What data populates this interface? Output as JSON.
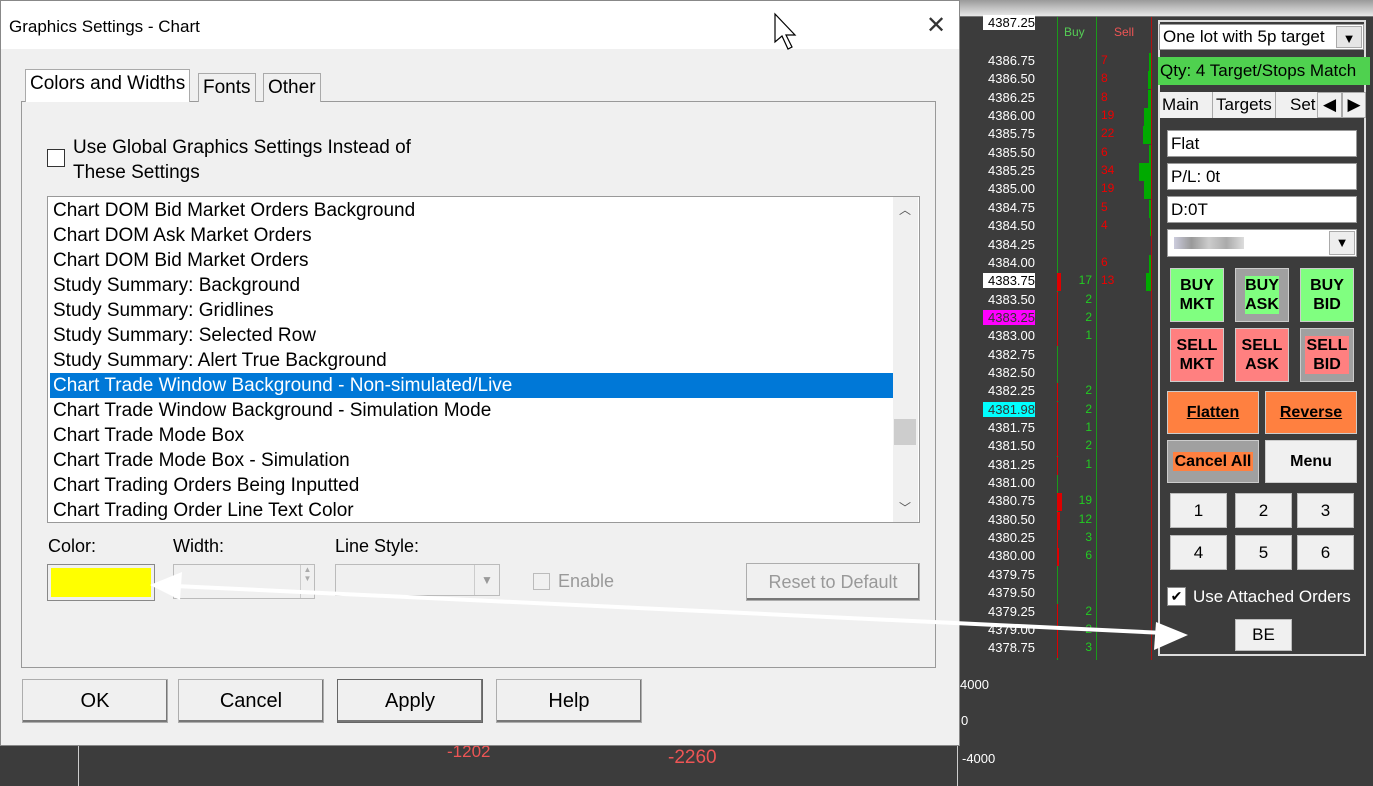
{
  "dialog": {
    "title": "Graphics Settings  - Chart",
    "tabs": [
      "Colors and Widths",
      "Fonts",
      "Other"
    ],
    "global_checkbox": {
      "label": "Use Global Graphics Settings Instead of These Settings",
      "checked": false
    },
    "items": [
      "Chart DOM Bid Market Orders Background",
      "Chart DOM Ask Market Orders",
      "Chart DOM Bid Market Orders",
      "Study Summary: Background",
      "Study Summary: Gridlines",
      "Study Summary: Selected Row",
      "Study Summary: Alert True Background",
      "Chart Trade Window Background - Non-simulated/Live",
      "Chart Trade Window Background - Simulation Mode",
      "Chart Trade Mode Box",
      "Chart Trade Mode Box - Simulation",
      "Chart Trading Orders Being Inputted",
      "Chart Trading Order Line Text Color"
    ],
    "selected_index": 7,
    "color_label": "Color:",
    "color_value": "#ffff00",
    "width_label": "Width:",
    "line_style_label": "Line Style:",
    "enable_label": "Enable",
    "reset_label": "Reset to Default",
    "buttons": {
      "ok": "OK",
      "cancel": "Cancel",
      "apply": "Apply",
      "help": "Help"
    }
  },
  "ladder": {
    "buy_header": "Buy",
    "sell_header": "Sell",
    "top_price": "4387.25",
    "rows": [
      [
        "4386.75",
        "",
        "7"
      ],
      [
        "4386.50",
        "",
        "8"
      ],
      [
        "4386.25",
        "",
        "8"
      ],
      [
        "4386.00",
        "",
        "19"
      ],
      [
        "4385.75",
        "",
        "22"
      ],
      [
        "4385.50",
        "",
        "6"
      ],
      [
        "4385.25",
        "",
        "34"
      ],
      [
        "4385.00",
        "",
        "19"
      ],
      [
        "4384.75",
        "",
        "5"
      ],
      [
        "4384.50",
        "",
        "4"
      ],
      [
        "4384.25",
        "",
        ""
      ],
      [
        "4384.00",
        "",
        "6"
      ],
      [
        "4383.75",
        "17",
        "13"
      ],
      [
        "4383.50",
        "2",
        ""
      ],
      [
        "4383.25",
        "2",
        ""
      ],
      [
        "4383.00",
        "1",
        ""
      ],
      [
        "4382.75",
        "",
        ""
      ],
      [
        "4382.50",
        "",
        ""
      ],
      [
        "4382.25",
        "2",
        ""
      ],
      [
        "4381.98",
        "2",
        ""
      ],
      [
        "4381.75",
        "1",
        ""
      ],
      [
        "4381.50",
        "2",
        ""
      ],
      [
        "4381.25",
        "1",
        ""
      ],
      [
        "4381.00",
        "",
        ""
      ],
      [
        "4380.75",
        "19",
        ""
      ],
      [
        "4380.50",
        "12",
        ""
      ],
      [
        "4380.25",
        "3",
        ""
      ],
      [
        "4380.00",
        "6",
        ""
      ],
      [
        "4379.75",
        "",
        ""
      ],
      [
        "4379.50",
        "",
        ""
      ],
      [
        "4379.25",
        "2",
        ""
      ],
      [
        "4379.00",
        "2",
        ""
      ],
      [
        "4378.75",
        "3",
        ""
      ]
    ],
    "highlights": {
      "4387.25": "#ffffff",
      "4383.75": "#ffffff",
      "4383.25": "#ff00ff",
      "4381.98": "#00ffff"
    }
  },
  "trade": {
    "preset": "One lot with 5p target",
    "status": "Qty: 4 Target/Stops Match",
    "status_color": "#4fd14f",
    "tabs": [
      "Main",
      "Targets",
      "Set"
    ],
    "position": "Flat",
    "pl": "P/L: 0t",
    "d": "D:0T",
    "buy_mkt": "BUY MKT",
    "buy_ask": "BUY ASK",
    "buy_bid": "BUY BID",
    "sell_mkt": "SELL MKT",
    "sell_ask": "SELL ASK",
    "sell_bid": "SELL BID",
    "flatten": "Flatten",
    "reverse": "Reverse",
    "cancel_all": "Cancel All",
    "menu": "Menu",
    "nums": [
      "1",
      "2",
      "3",
      "4",
      "5",
      "6"
    ],
    "attached_label": "Use Attached Orders",
    "attached_checked": true,
    "be": "BE"
  },
  "chart": {
    "labels": [
      "-1202",
      "-2260"
    ],
    "axis": [
      "4000",
      "0",
      "-4000"
    ]
  }
}
